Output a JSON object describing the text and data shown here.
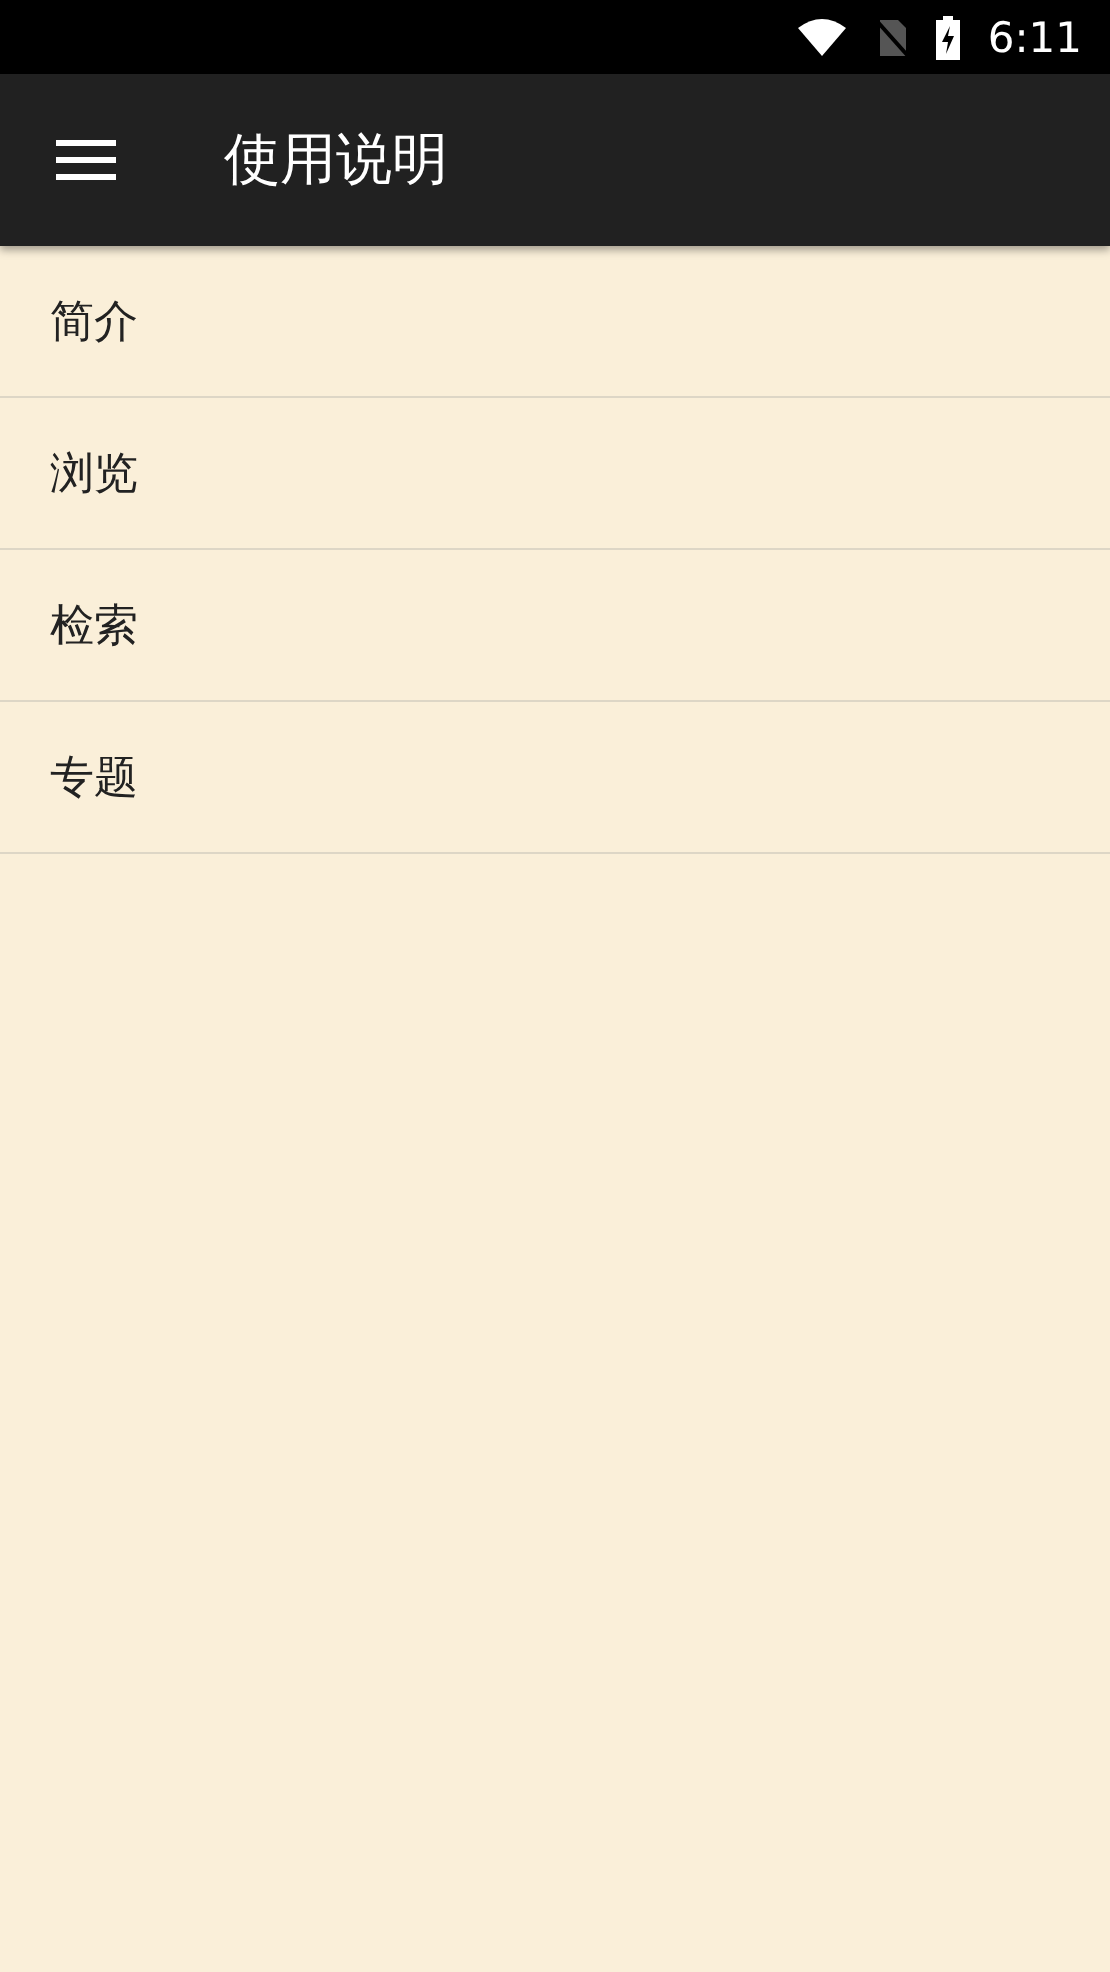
{
  "status_bar": {
    "time": "6:11"
  },
  "app_bar": {
    "title": "使用说明"
  },
  "items": [
    {
      "label": "简介"
    },
    {
      "label": "浏览"
    },
    {
      "label": "检索"
    },
    {
      "label": "专题"
    }
  ]
}
